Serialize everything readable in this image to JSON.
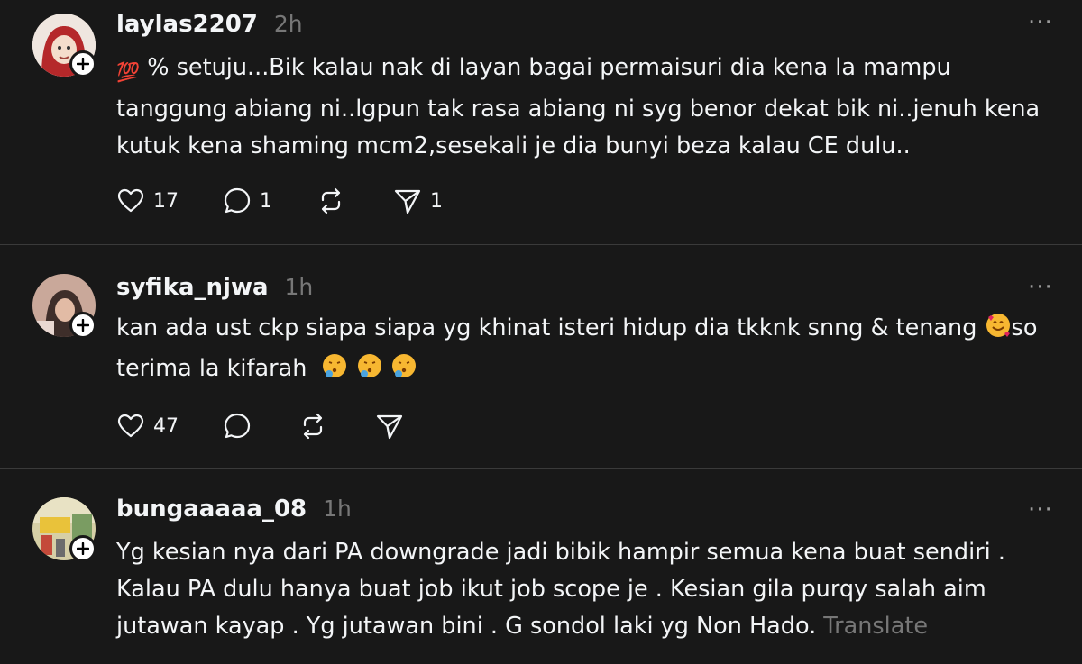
{
  "posts": [
    {
      "username": "laylas2207",
      "time": "2h",
      "emoji_prefix": "💯",
      "text": "% setuju...Bik kalau nak di layan bagai permaisuri dia kena la mampu tanggung abiang ni..lgpun tak rasa abiang ni syg benor dekat bik ni..jenuh kena kutuk kena shaming mcm2,sesekali je dia bunyi beza kalau CE dulu..",
      "likes": "17",
      "replies": "1",
      "reposts": "",
      "shares": "1"
    },
    {
      "username": "syfika_njwa",
      "time": "1h",
      "text_part1": "kan ada ust ckp siapa siapa yg khinat isteri hidup dia tkknk snng & tenang",
      "text_part2": "so terima la kifarah",
      "likes": "47",
      "replies": "",
      "reposts": "",
      "shares": ""
    },
    {
      "username": "bungaaaaa_08",
      "time": "1h",
      "text": "Yg kesian nya dari PA downgrade jadi bibik hampir semua kena buat sendiri . Kalau PA dulu hanya buat job ikut job scope je . Kesian gila purqy salah aim jutawan kayap . Yg jutawan bini . G sondol laki yg Non Hado.",
      "translate_label": "Translate"
    }
  ],
  "icons": {
    "like": "heart-icon",
    "reply": "comment-icon",
    "repost": "repost-icon",
    "share": "send-icon",
    "more": "more-icon",
    "follow": "plus-icon"
  },
  "colors": {
    "background": "#181818",
    "text": "#f3f5f7",
    "muted": "#777777",
    "divider": "#3a3a3a"
  }
}
